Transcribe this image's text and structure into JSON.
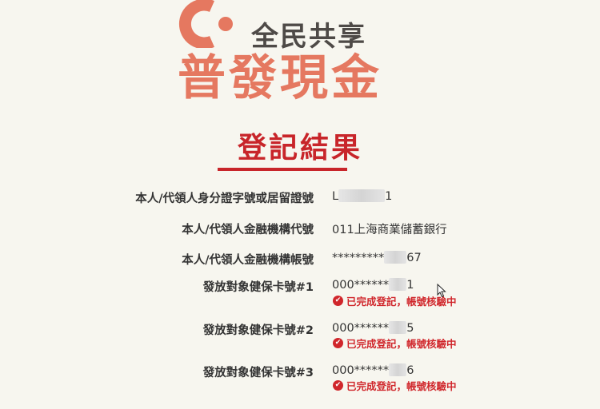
{
  "header": {
    "tagline": "全民共享",
    "headline": "普發現金"
  },
  "result_title": "登記結果",
  "rows": [
    {
      "label": "本人/代領人身分證字號或居留證號",
      "value_prefix": "L",
      "value_suffix": "1"
    },
    {
      "label": "本人/代領人金融機構代號",
      "value_prefix": "011上海商業儲蓄銀行",
      "value_suffix": ""
    },
    {
      "label": "本人/代領人金融機構帳號",
      "value_prefix": "*********",
      "value_suffix": "67"
    },
    {
      "label": "發放對象健保卡號#1",
      "value_prefix": "000******",
      "value_suffix": "1",
      "status": "已完成登記，帳號核驗中"
    },
    {
      "label": "發放對象健保卡號#2",
      "value_prefix": "000******",
      "value_suffix": "5",
      "status": "已完成登記，帳號核驗中"
    },
    {
      "label": "發放對象健保卡號#3",
      "value_prefix": "000******",
      "value_suffix": "6",
      "status": "已完成登記，帳號核驗中"
    }
  ],
  "colors": {
    "background": "#f7f6ef",
    "brand_orange": "#e57860",
    "title_red": "#c8252a",
    "status_red": "#d0262b",
    "text_dark": "#333333"
  },
  "icons": {
    "logo": "c-logo-icon",
    "status": "check-circle-icon",
    "cursor": "mouse-pointer-icon"
  }
}
